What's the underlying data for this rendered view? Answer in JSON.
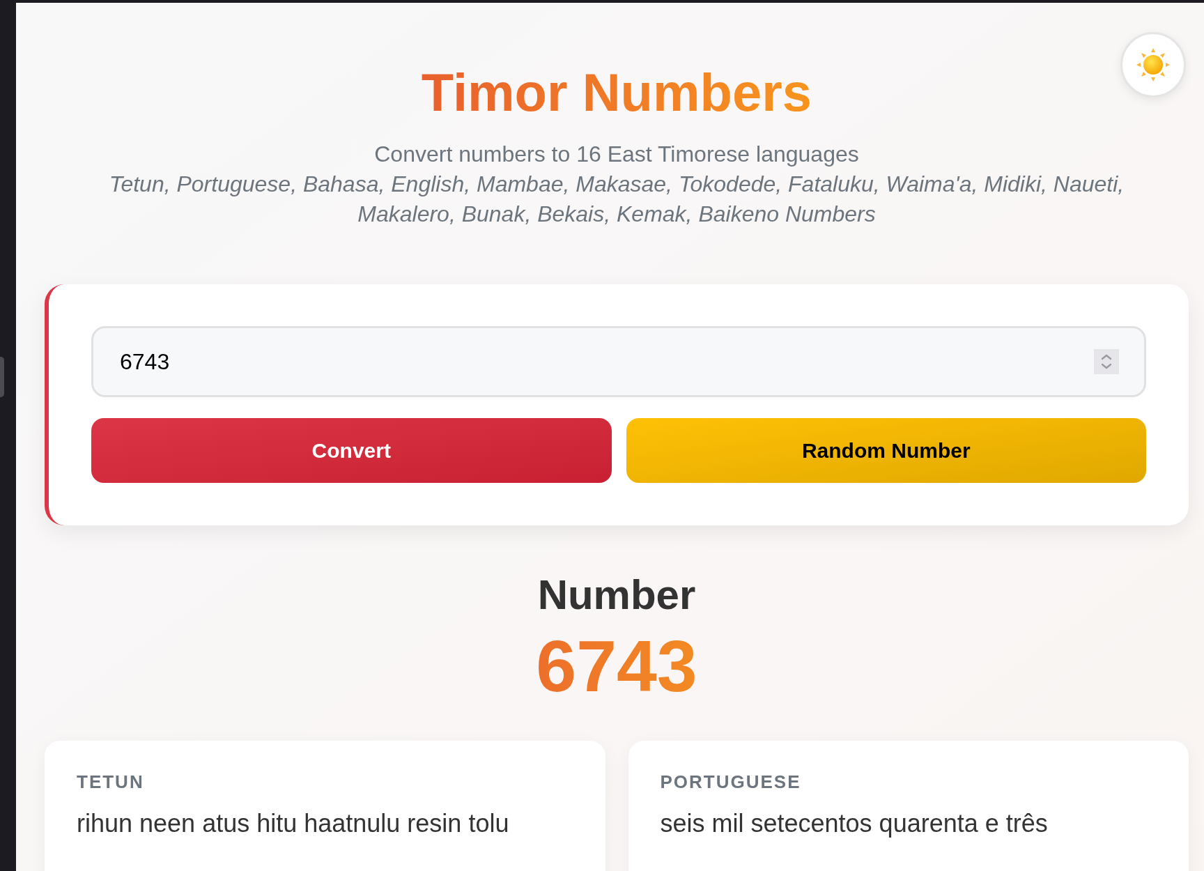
{
  "header": {
    "title": "Timor Numbers",
    "subtitle": "Convert numbers to 16 East Timorese languages",
    "languages": "Tetun, Portuguese, Bahasa, English, Mambae, Makasae, Tokodede, Fataluku, Waima'a, Midiki, Naueti, Makalero, Bunak, Bekais, Kemak, Baikeno Numbers"
  },
  "converter": {
    "input": {
      "value": "6743"
    },
    "buttons": [
      {
        "label": "Convert",
        "kind": "primary"
      },
      {
        "label": "Random Number",
        "kind": "secondary"
      }
    ]
  },
  "result": {
    "heading": "Number",
    "value": "6743"
  },
  "translations": [
    {
      "language": "TETUN",
      "text": "rihun neen atus hitu haatnulu resin tolu"
    },
    {
      "language": "PORTUGUESE",
      "text": "seis mil setecentos quarenta e três"
    }
  ]
}
